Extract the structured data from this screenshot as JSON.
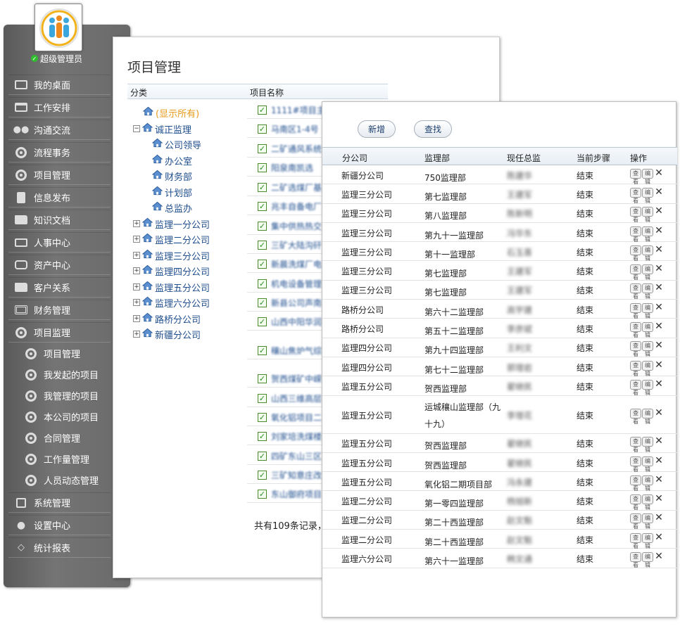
{
  "sidebar": {
    "user_role": "超级管理员",
    "items": [
      {
        "label": "我的桌面",
        "icon": "desktop-icon"
      },
      {
        "label": "工作安排",
        "icon": "calendar-icon"
      },
      {
        "label": "沟通交流",
        "icon": "users-icon"
      },
      {
        "label": "流程事务",
        "icon": "gear-icon"
      },
      {
        "label": "项目管理",
        "icon": "gear-icon"
      },
      {
        "label": "信息发布",
        "icon": "document-icon"
      },
      {
        "label": "知识文档",
        "icon": "folder-icon"
      },
      {
        "label": "人事中心",
        "icon": "id-card-icon"
      },
      {
        "label": "资产中心",
        "icon": "camera-icon"
      },
      {
        "label": "客户关系",
        "icon": "folder-icon"
      },
      {
        "label": "财务管理",
        "icon": "calculator-icon"
      },
      {
        "label": "项目监理",
        "icon": "gear-icon"
      }
    ],
    "sub_items": [
      "项目管理",
      "我发起的项目",
      "我管理的项目",
      "本公司的项目",
      "合同管理",
      "工作量管理",
      "人员动态管理"
    ],
    "bottom_items": [
      {
        "label": "系统管理",
        "icon": "system-icon"
      },
      {
        "label": "设置中心",
        "icon": "wrench-icon"
      },
      {
        "label": "统计报表",
        "icon": "chart-icon"
      }
    ]
  },
  "project_page": {
    "title": "项目管理",
    "col_category": "分类",
    "col_name": "项目名称",
    "tree": [
      {
        "label": "(显示所有)",
        "level": 0,
        "toggle": "",
        "highlight": true
      },
      {
        "label": "诚正监理",
        "level": 0,
        "toggle": "−"
      },
      {
        "label": "公司领导",
        "level": 1,
        "toggle": ""
      },
      {
        "label": "办公室",
        "level": 1,
        "toggle": ""
      },
      {
        "label": "财务部",
        "level": 1,
        "toggle": ""
      },
      {
        "label": "计划部",
        "level": 1,
        "toggle": ""
      },
      {
        "label": "总监办",
        "level": 1,
        "toggle": ""
      },
      {
        "label": "监理一分公司",
        "level": 0,
        "toggle": "+"
      },
      {
        "label": "监理二分公司",
        "level": 0,
        "toggle": "+"
      },
      {
        "label": "监理三分公司",
        "level": 0,
        "toggle": "+"
      },
      {
        "label": "监理四分公司",
        "level": 0,
        "toggle": "+"
      },
      {
        "label": "监理五分公司",
        "level": 0,
        "toggle": "+"
      },
      {
        "label": "监理六分公司",
        "level": 0,
        "toggle": "+"
      },
      {
        "label": "路桥分公司",
        "level": 0,
        "toggle": "+"
      },
      {
        "label": "新疆分公司",
        "level": 0,
        "toggle": "+"
      }
    ],
    "projects": [
      "1111#项目主",
      "马南区1-4号",
      "二矿通风系统",
      "阳泉南凯选",
      "二矿选煤厂基",
      "兆丰自备电厂",
      "集中供热热交",
      "三矿大陆沟矸",
      "新晨洗煤厂电",
      "机电设备管理",
      "新县公司声南",
      "山西中阳华润",
      "穰山焦炉气综",
      "贺西煤矿中嵘",
      "山西三维高层",
      "氧化铝项目二",
      "刘家培洗煤楼",
      "四矿东山三区",
      "三矿知意庄改",
      "东山御府项目"
    ],
    "footer": "共有109条记录，"
  },
  "list_page": {
    "btn_add": "新增",
    "btn_search": "查找",
    "headers": {
      "company": "分公司",
      "dept": "监理部",
      "director": "现任总监",
      "step": "当前步骤",
      "ops": "操作"
    },
    "op_labels": {
      "view": "查看",
      "edit": "编辑",
      "delete": "✕"
    },
    "rows": [
      {
        "company": "新疆分公司",
        "dept": "750监理部",
        "director": "陈建华",
        "step": "结束"
      },
      {
        "company": "监理三分公司",
        "dept": "第七监理部",
        "director": "王建军",
        "step": "结束"
      },
      {
        "company": "监理三分公司",
        "dept": "第八监理部",
        "director": "陈新明",
        "step": "结束"
      },
      {
        "company": "监理三分公司",
        "dept": "第九十一监理部",
        "director": "冯华东",
        "step": "结束"
      },
      {
        "company": "监理三分公司",
        "dept": "第十一监理部",
        "director": "石玉喜",
        "step": "结束"
      },
      {
        "company": "监理三分公司",
        "dept": "第七监理部",
        "director": "王建军",
        "step": "结束"
      },
      {
        "company": "监理三分公司",
        "dept": "第七监理部",
        "director": "王建军",
        "step": "结束"
      },
      {
        "company": "路桥分公司",
        "dept": "第六十二监理部",
        "director": "高宇建",
        "step": "结束"
      },
      {
        "company": "路桥分公司",
        "dept": "第五十二监理部",
        "director": "李彦斌",
        "step": "结束"
      },
      {
        "company": "监理四分公司",
        "dept": "第九十四监理部",
        "director": "王利文",
        "step": "结束"
      },
      {
        "company": "监理四分公司",
        "dept": "第七十二监理部",
        "director": "郭增岩",
        "step": "结束"
      },
      {
        "company": "监理五分公司",
        "dept": "贺西监理部",
        "director": "翟继民",
        "step": "结束"
      },
      {
        "company": "监理五分公司",
        "dept": "运城穰山监理部（九十九）",
        "director": "李增花",
        "step": "结束"
      },
      {
        "company": "监理五分公司",
        "dept": "贺西监理部",
        "director": "翟继民",
        "step": "结束"
      },
      {
        "company": "监理五分公司",
        "dept": "贺西监理部",
        "director": "翟继民",
        "step": "结束"
      },
      {
        "company": "监理五分公司",
        "dept": "氧化铝二期项目部",
        "director": "冯永建",
        "step": "结束"
      },
      {
        "company": "监理二分公司",
        "dept": "第一零四监理部",
        "director": "杨旭新",
        "step": "结束"
      },
      {
        "company": "监理二分公司",
        "dept": "第二十西监理部",
        "director": "赵文魁",
        "step": "结束"
      },
      {
        "company": "监理二分公司",
        "dept": "第二十西监理部",
        "director": "赵文魁",
        "step": "结束"
      },
      {
        "company": "监理六分公司",
        "dept": "第六十一监理部",
        "director": "韩文通",
        "step": "结束"
      }
    ]
  },
  "colors": {
    "link": "#1f4e8e",
    "highlight": "#e89a1a",
    "sidebar": "#6a6a6a"
  }
}
